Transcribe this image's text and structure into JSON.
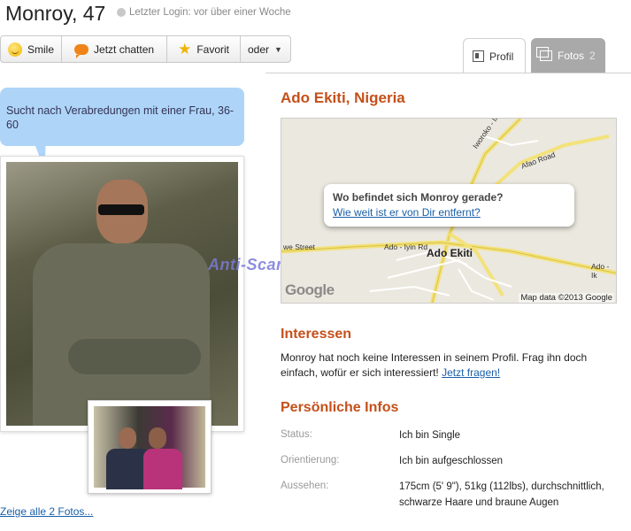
{
  "header": {
    "name": "Monroy, 47",
    "last_login": "Letzter Login: vor über einer Woche"
  },
  "actions": {
    "smile": "Smile",
    "chat": "Jetzt chatten",
    "favorite": "Favorit",
    "more": "oder"
  },
  "tabs": {
    "profil": "Profil",
    "fotos": "Fotos",
    "fotos_count": "2"
  },
  "bubble": {
    "text": "Sucht nach Verabredungen mit einer Frau, 36-60"
  },
  "photos": {
    "watermark": "Anti-Scam-Forum-NL",
    "show_all": "Zeige alle 2 Fotos..."
  },
  "location": {
    "title": "Ado Ekiti, Nigeria"
  },
  "map": {
    "question": "Wo befindet sich Monroy gerade?",
    "distance_link": "Wie weit ist er von Dir entfernt?",
    "city": "Ado Ekiti",
    "roads": [
      "Iworoko - Ifaki Road",
      "Afao Road",
      "we Street",
      "Ado - Iyin Rd",
      "Ado - Ik"
    ],
    "logo": "Google",
    "credit": "Map data ©2013 Google"
  },
  "interests": {
    "heading": "Interessen",
    "text": "Monroy hat noch keine Interessen in seinem Profil. Frag ihn doch einfach, wofür er sich interessiert!",
    "link": "Jetzt fragen!"
  },
  "personal": {
    "heading": "Persönliche Infos",
    "rows": [
      {
        "label": "Status:",
        "value": "Ich bin Single"
      },
      {
        "label": "Orientierung:",
        "value": "Ich bin aufgeschlossen"
      },
      {
        "label": "Aussehen:",
        "value": "175cm (5' 9\"), 51kg (112lbs), durchschnittlich, schwarze Haare und braune Augen"
      }
    ]
  },
  "colors": {
    "accent": "#c4501a",
    "link": "#1a5fa8",
    "bubble": "#aed5f8"
  }
}
